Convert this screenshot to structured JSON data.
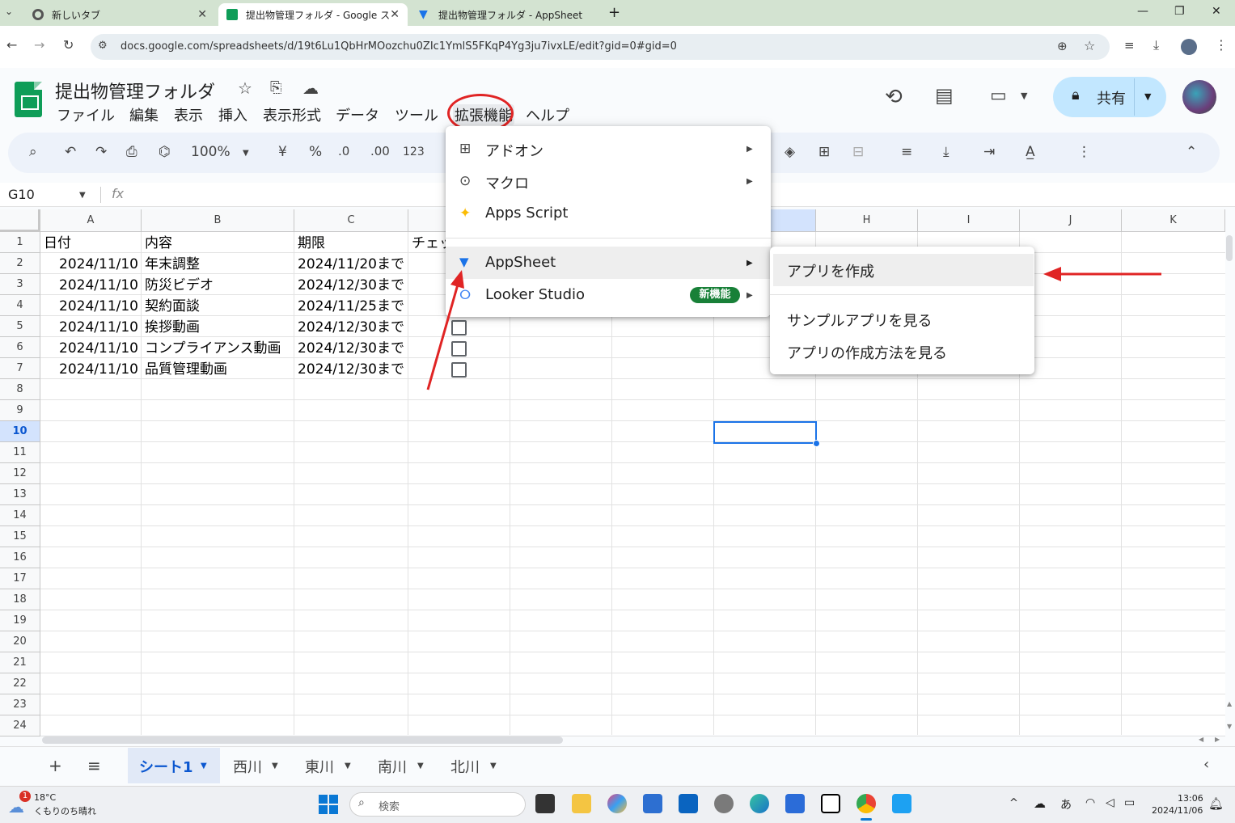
{
  "browser": {
    "tabs": [
      {
        "label": "新しいタブ"
      },
      {
        "label": "提出物管理フォルダ - Google ス"
      },
      {
        "label": "提出物管理フォルダ - AppSheet"
      }
    ],
    "url": "docs.google.com/spreadsheets/d/19t6Lu1QbHrMOozchu0ZIc1YmlS5FKqP4Yg3ju7ivxLE/edit?gid=0#gid=0"
  },
  "sheets": {
    "doc_title": "提出物管理フォルダ",
    "menu": [
      "ファイル",
      "編集",
      "表示",
      "挿入",
      "表示形式",
      "データ",
      "ツール",
      "拡張機能",
      "ヘルプ"
    ],
    "share_label": "共有",
    "toolbar": {
      "zoom": "100%",
      "currency": "¥",
      "percent": "%",
      "dec_dec": ".0",
      "dec_inc": ".00",
      "format": "123"
    },
    "name_box": "G10",
    "fx": "fx",
    "columns": [
      "A",
      "B",
      "C",
      "",
      "",
      "",
      "",
      "H",
      "I",
      "J",
      "K"
    ],
    "rows": [
      "1",
      "2",
      "3",
      "4",
      "5",
      "6",
      "7",
      "8",
      "9",
      "10",
      "11",
      "12",
      "13",
      "14",
      "15",
      "16",
      "17",
      "18",
      "19",
      "20",
      "21",
      "22",
      "23",
      "24"
    ],
    "header_row": [
      "日付",
      "内容",
      "期限",
      "チェッ"
    ],
    "data_rows": [
      [
        "2024/11/10",
        "年末調整",
        "2024/11/20まで"
      ],
      [
        "2024/11/10",
        "防災ビデオ",
        "2024/12/30まで"
      ],
      [
        "2024/11/10",
        "契約面談",
        "2024/11/25まで"
      ],
      [
        "2024/11/10",
        "挨拶動画",
        "2024/12/30まで"
      ],
      [
        "2024/11/10",
        "コンプライアンス動画",
        "2024/12/30まで"
      ],
      [
        "2024/11/10",
        "品質管理動画",
        "2024/12/30まで"
      ]
    ],
    "sheet_tabs": [
      "シート1",
      "西川",
      "東川",
      "南川",
      "北川"
    ]
  },
  "extensions_menu": {
    "items": [
      "アドオン",
      "マクロ",
      "Apps Script",
      "AppSheet",
      "Looker Studio"
    ],
    "new_badge": "新機能"
  },
  "appsheet_submenu": {
    "items": [
      "アプリを作成",
      "サンプルアプリを見る",
      "アプリの作成方法を見る"
    ]
  },
  "taskbar": {
    "weather_temp": "18°C",
    "weather_desc": "くもりのち晴れ",
    "weather_badge": "1",
    "search_placeholder": "検索",
    "ime": "あ",
    "time": "13:06",
    "date": "2024/11/06"
  },
  "colors": {
    "accent": "#1a73e8",
    "sheets_green": "#0f9d58",
    "annotation_red": "#e02424",
    "badge_green": "#188038"
  }
}
